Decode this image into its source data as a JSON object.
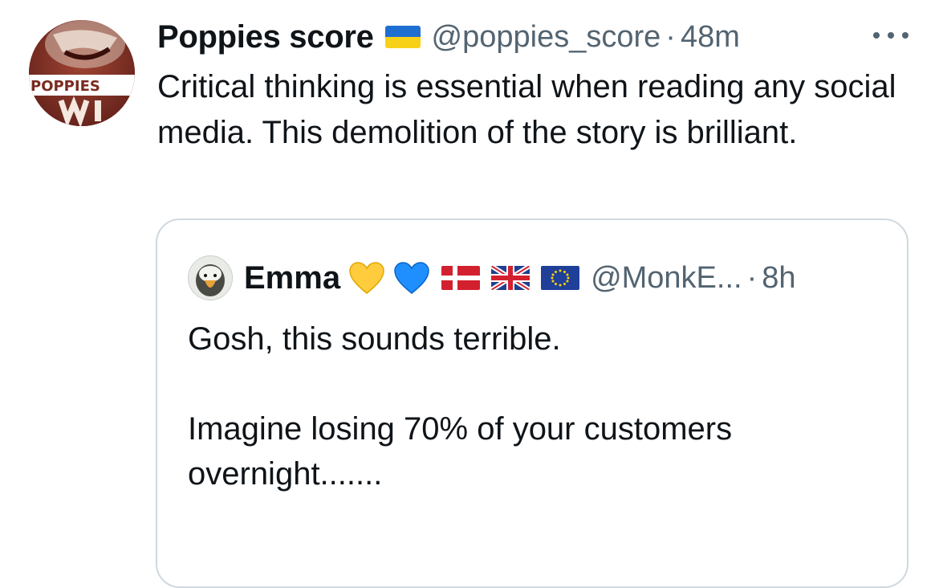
{
  "tweet": {
    "author_name": "Poppies score",
    "author_flag_icon": "ukraine-flag-icon",
    "handle": "@poppies_score",
    "separator": "·",
    "time": "48m",
    "more_icon": "more-dots-icon",
    "avatar_text": "POPPIES",
    "text": "Critical thinking is essential when reading any social media. This demolition of the story is brilliant."
  },
  "quoted_tweet": {
    "author_name": "Emma",
    "emoji_icons": [
      "yellow-heart-icon",
      "blue-heart-icon",
      "denmark-flag-icon",
      "uk-flag-icon",
      "eu-flag-icon"
    ],
    "handle": "@MonkE...",
    "separator": "·",
    "time": "8h",
    "text": "Gosh, this sounds terrible.\n\nImagine losing 70% of your customers overnight......."
  },
  "colors": {
    "text_primary": "#0f1419",
    "text_secondary": "#536471",
    "border": "#cfd9de",
    "background": "#ffffff"
  }
}
